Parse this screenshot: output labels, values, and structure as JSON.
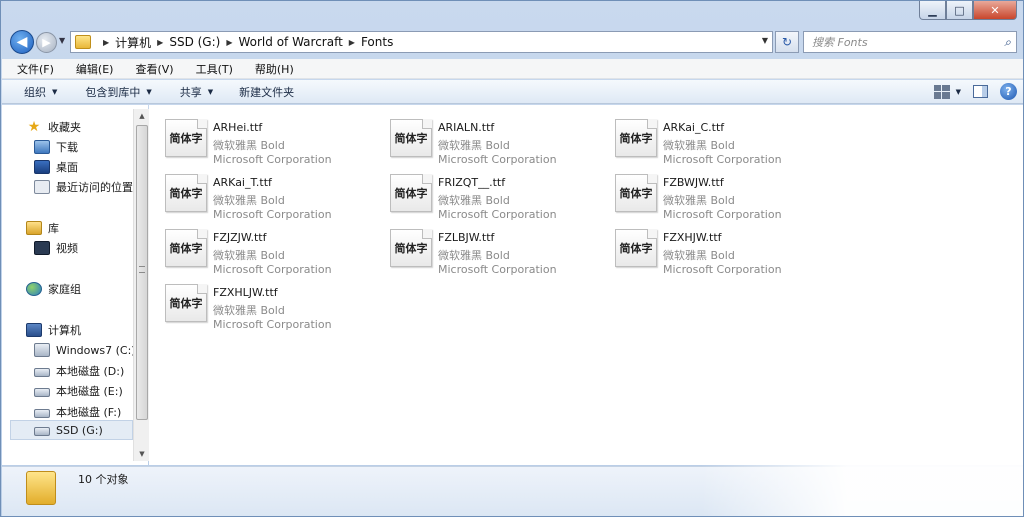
{
  "address": {
    "crumbs": [
      "计算机",
      "SSD (G:)",
      "World of Warcraft",
      "Fonts"
    ]
  },
  "search": {
    "placeholder": "搜索 Fonts"
  },
  "menu": [
    "文件(F)",
    "编辑(E)",
    "查看(V)",
    "工具(T)",
    "帮助(H)"
  ],
  "toolbar": {
    "organize": "组织",
    "include_in_library": "包含到库中",
    "share": "共享",
    "new_folder": "新建文件夹"
  },
  "nav": {
    "favorites": "收藏夹",
    "downloads": "下载",
    "desktop": "桌面",
    "recent": "最近访问的位置",
    "libraries": "库",
    "videos": "视频",
    "homegroup": "家庭组",
    "computer": "计算机",
    "drive_c": "Windows7 (C:)",
    "drive_d": "本地磁盘 (D:)",
    "drive_e": "本地磁盘 (E:)",
    "drive_f": "本地磁盘 (F:)",
    "drive_g": "SSD (G:)"
  },
  "files": [
    {
      "thumb": "简体字",
      "name": "ARHei.ttf",
      "style": "微软雅黑 Bold",
      "company": "Microsoft Corporation"
    },
    {
      "thumb": "简体字",
      "name": "ARIALN.ttf",
      "style": "微软雅黑 Bold",
      "company": "Microsoft Corporation"
    },
    {
      "thumb": "简体字",
      "name": "ARKai_C.ttf",
      "style": "微软雅黑 Bold",
      "company": "Microsoft Corporation"
    },
    {
      "thumb": "简体字",
      "name": "ARKai_T.ttf",
      "style": "微软雅黑 Bold",
      "company": "Microsoft Corporation"
    },
    {
      "thumb": "简体字",
      "name": "FRIZQT__.ttf",
      "style": "微软雅黑 Bold",
      "company": "Microsoft Corporation"
    },
    {
      "thumb": "简体字",
      "name": "FZBWJW.ttf",
      "style": "微软雅黑 Bold",
      "company": "Microsoft Corporation"
    },
    {
      "thumb": "简体字",
      "name": "FZJZJW.ttf",
      "style": "微软雅黑 Bold",
      "company": "Microsoft Corporation"
    },
    {
      "thumb": "简体字",
      "name": "FZLBJW.ttf",
      "style": "微软雅黑 Bold",
      "company": "Microsoft Corporation"
    },
    {
      "thumb": "简体字",
      "name": "FZXHJW.ttf",
      "style": "微软雅黑 Bold",
      "company": "Microsoft Corporation"
    },
    {
      "thumb": "简体字",
      "name": "FZXHLJW.ttf",
      "style": "微软雅黑 Bold",
      "company": "Microsoft Corporation"
    }
  ],
  "status": {
    "count": "10 个对象"
  }
}
